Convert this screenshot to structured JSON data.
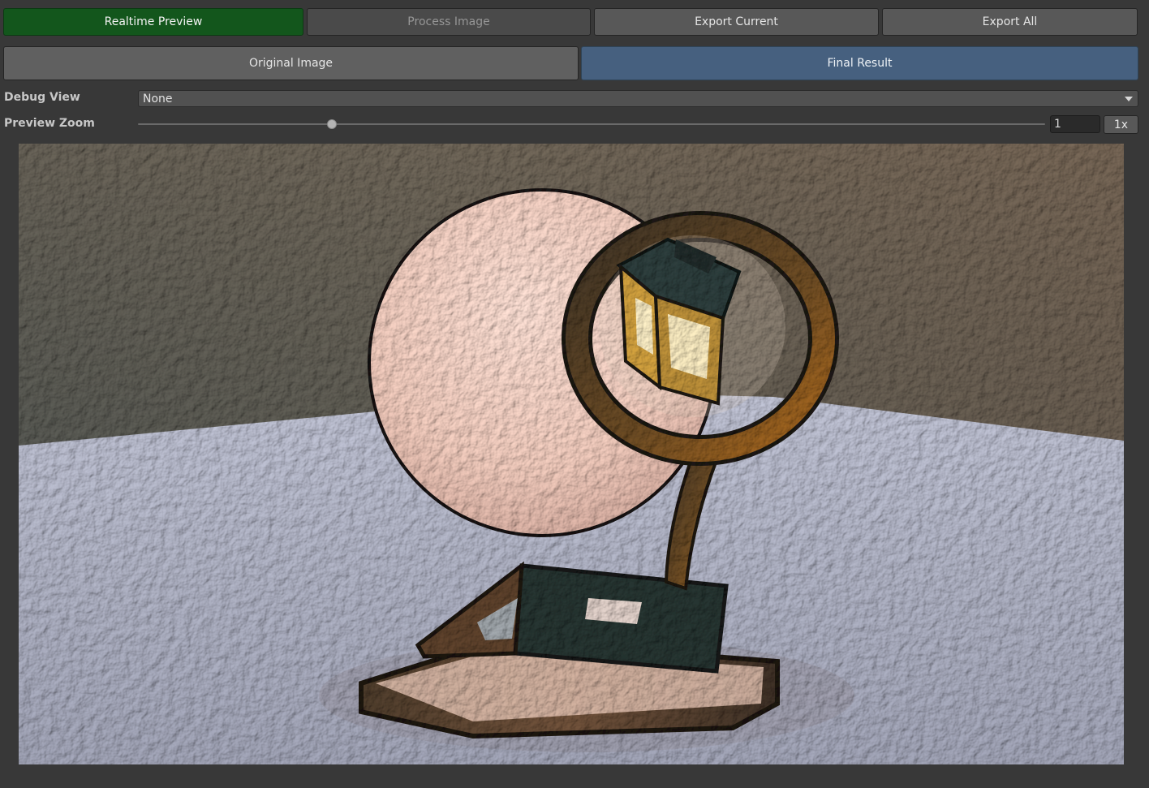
{
  "toolbar": {
    "realtime_preview": "Realtime Preview",
    "process_image": "Process Image",
    "export_current": "Export Current",
    "export_all": "Export All"
  },
  "tabs": [
    {
      "label": "Original Image",
      "active": false
    },
    {
      "label": "Final Result",
      "active": true
    }
  ],
  "debug_view": {
    "label": "Debug View",
    "value": "None"
  },
  "preview_zoom": {
    "label": "Preview Zoom",
    "value": "1",
    "slider_fraction": 0.214,
    "reset_label": "1x"
  },
  "colors": {
    "primary_green": "#13561c",
    "active_tab_blue": "#46607f",
    "panel_bg": "#383838"
  }
}
